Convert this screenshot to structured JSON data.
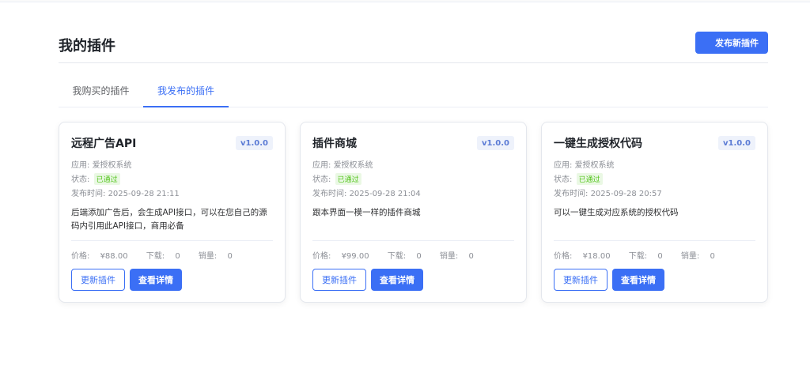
{
  "page": {
    "title": "我的插件",
    "publish_label": "发布新插件"
  },
  "tabs": [
    {
      "label": "我购买的插件",
      "active": false
    },
    {
      "label": "我发布的插件",
      "active": true
    }
  ],
  "colors": {
    "accent": "#3b6ff5",
    "success": "#52c41a"
  },
  "labels": {
    "app": "应用: ",
    "status": "状态: ",
    "time": "发布时间: ",
    "price": "价格: ",
    "downloads": "下载: ",
    "sales": "销量: ",
    "update": "更新插件",
    "detail": "查看详情"
  },
  "plugins": [
    {
      "name": "远程广告API",
      "version": "v1.0.0",
      "app": "爱授权系统",
      "status": "已通过",
      "time": "2025-09-28 21:11",
      "desc": "后端添加广告后，会生成API接口，可以在您自己的源码内引用此API接口，商用必备",
      "price": "¥88.00",
      "downloads": "0",
      "sales": "0"
    },
    {
      "name": "插件商城",
      "version": "v1.0.0",
      "app": "爱授权系统",
      "status": "已通过",
      "time": "2025-09-28 21:04",
      "desc": "跟本界面一模一样的插件商城",
      "price": "¥99.00",
      "downloads": "0",
      "sales": "0"
    },
    {
      "name": "一键生成授权代码",
      "version": "v1.0.0",
      "app": "爱授权系统",
      "status": "已通过",
      "time": "2025-09-28 20:57",
      "desc": "可以一键生成对应系统的授权代码",
      "price": "¥18.00",
      "downloads": "0",
      "sales": "0"
    }
  ]
}
